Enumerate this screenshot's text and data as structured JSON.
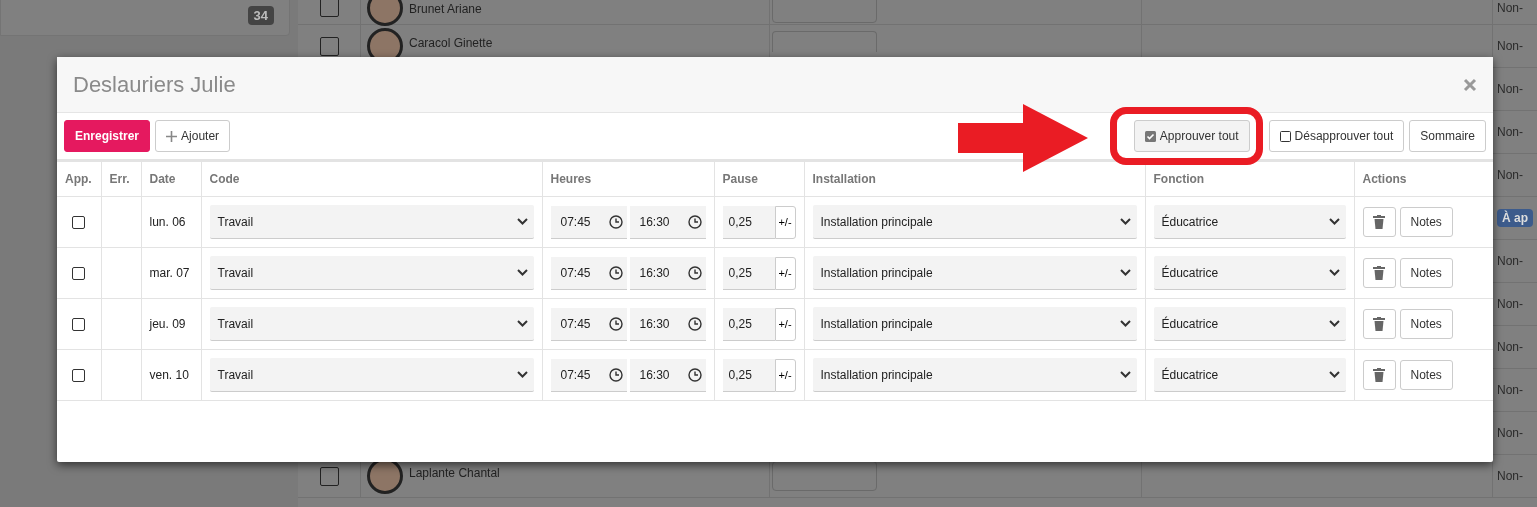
{
  "background": {
    "count_badge": "34",
    "rows": [
      {
        "name": "Brunet Ariane",
        "checked": false,
        "status": "Non-",
        "kind": "text"
      },
      {
        "name": "Caracol Ginette",
        "checked": false,
        "status": "Non-",
        "kind": "text"
      },
      {
        "status": "Non-",
        "kind": "text"
      },
      {
        "status": "Non-",
        "kind": "text"
      },
      {
        "status": "Non-",
        "kind": "text"
      },
      {
        "status": "À ap",
        "kind": "badge"
      },
      {
        "status": "Non-",
        "kind": "text"
      },
      {
        "status": "Non-",
        "kind": "text"
      },
      {
        "status": "Non-",
        "kind": "text"
      },
      {
        "status": "Non-",
        "kind": "text"
      },
      {
        "status": "Non-",
        "kind": "text"
      },
      {
        "name": "Laplante Chantal",
        "checked": false,
        "status": "Non-",
        "kind": "text"
      }
    ]
  },
  "dialog": {
    "title": "Deslauriers Julie",
    "toolbar": {
      "save": "Enregistrer",
      "add": "Ajouter",
      "approve_all": {
        "label": "Approuver tout",
        "checked": true
      },
      "unapprove_all": {
        "label": "Désapprouver tout",
        "checked": false
      },
      "summary": "Sommaire"
    },
    "table": {
      "columns": [
        "App.",
        "Err.",
        "Date",
        "Code",
        "Heures",
        "Pause",
        "Installation",
        "Fonction",
        "Actions"
      ],
      "rows": [
        {
          "approved": false,
          "date": "lun. 06",
          "code": "Travail",
          "start": "07:45",
          "end": "16:30",
          "pause": "0,25",
          "pause_toggle": "+/-",
          "installation": "Installation principale",
          "function": "Éducatrice",
          "notes": "Notes"
        },
        {
          "approved": false,
          "date": "mar. 07",
          "code": "Travail",
          "start": "07:45",
          "end": "16:30",
          "pause": "0,25",
          "pause_toggle": "+/-",
          "installation": "Installation principale",
          "function": "Éducatrice",
          "notes": "Notes"
        },
        {
          "approved": false,
          "date": "jeu. 09",
          "code": "Travail",
          "start": "07:45",
          "end": "16:30",
          "pause": "0,25",
          "pause_toggle": "+/-",
          "installation": "Installation principale",
          "function": "Éducatrice",
          "notes": "Notes"
        },
        {
          "approved": false,
          "date": "ven. 10",
          "code": "Travail",
          "start": "07:45",
          "end": "16:30",
          "pause": "0,25",
          "pause_toggle": "+/-",
          "installation": "Installation principale",
          "function": "Éducatrice",
          "notes": "Notes"
        }
      ]
    }
  }
}
